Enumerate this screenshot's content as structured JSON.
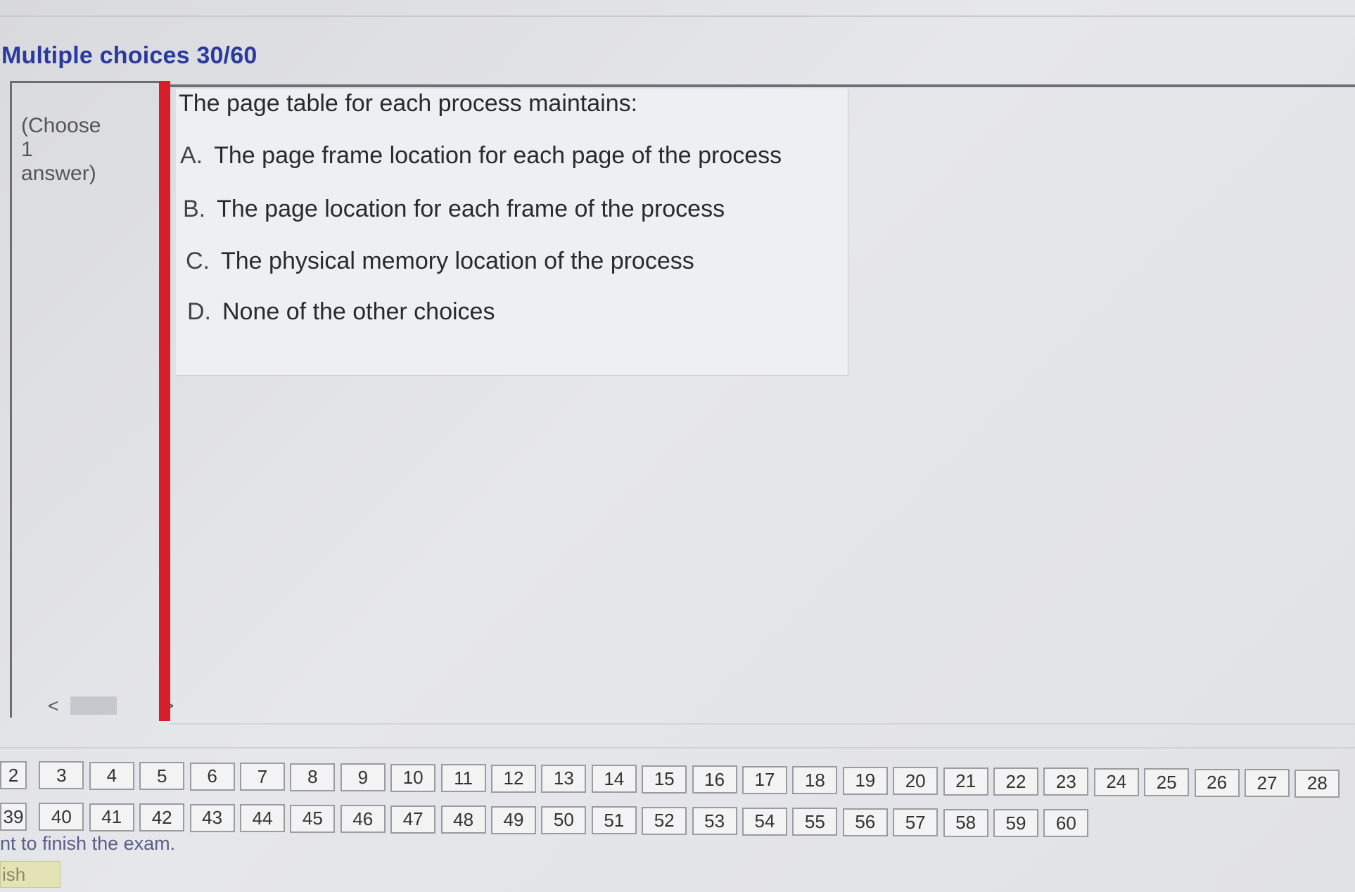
{
  "header": {
    "title": "Multiple choices 30/60"
  },
  "left_panel": {
    "hint": "(Choose\n1\nanswer)",
    "scroll_left": "<",
    "scroll_right": ">"
  },
  "question": {
    "text": "The page table for each process maintains:",
    "options": [
      {
        "letter": "A.",
        "text": "The page frame location for each page of the process"
      },
      {
        "letter": "B.",
        "text": "The page location for each frame of the process"
      },
      {
        "letter": "C.",
        "text": "The physical memory location of the process"
      },
      {
        "letter": "D.",
        "text": "None of the other choices"
      }
    ]
  },
  "navigation": {
    "row1": [
      "2",
      "3",
      "4",
      "5",
      "6",
      "7",
      "8",
      "9",
      "10",
      "11",
      "12",
      "13",
      "14",
      "15",
      "16",
      "17",
      "18",
      "19",
      "20",
      "21",
      "22",
      "23",
      "24",
      "25",
      "26",
      "27",
      "28"
    ],
    "row2": [
      "39",
      "40",
      "41",
      "42",
      "43",
      "44",
      "45",
      "46",
      "47",
      "48",
      "49",
      "50",
      "51",
      "52",
      "53",
      "54",
      "55",
      "56",
      "57",
      "58",
      "59",
      "60"
    ]
  },
  "footer": {
    "hint": "nt to finish the exam.",
    "finish_label": "ish"
  }
}
